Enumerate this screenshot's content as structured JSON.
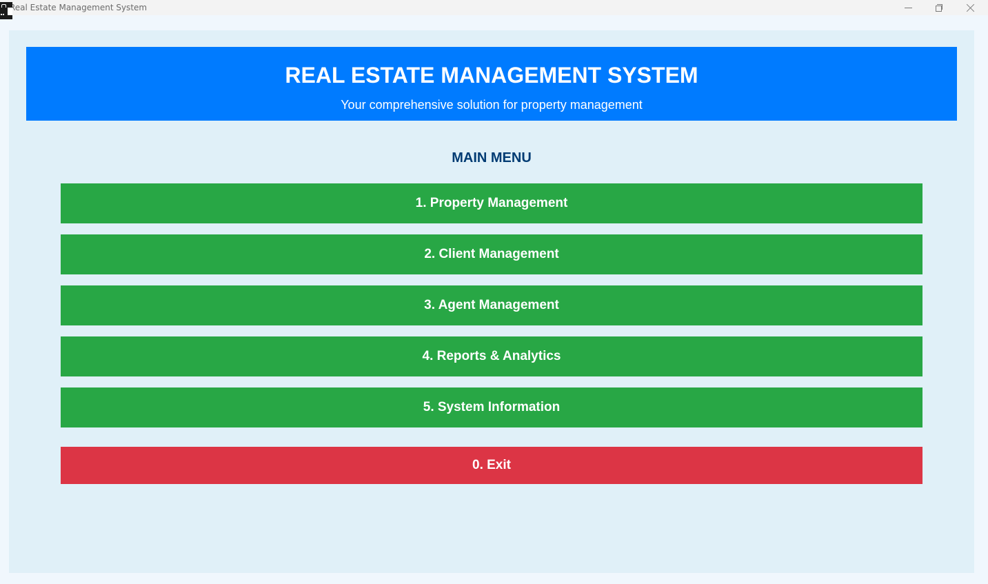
{
  "window": {
    "title": "Real Estate Management System"
  },
  "header": {
    "title": "REAL ESTATE MANAGEMENT SYSTEM",
    "subtitle": "Your comprehensive solution for property management"
  },
  "menu": {
    "title": "MAIN MENU",
    "items": [
      {
        "label": "1. Property Management"
      },
      {
        "label": "2. Client Management"
      },
      {
        "label": "3. Agent Management"
      },
      {
        "label": "4. Reports & Analytics"
      },
      {
        "label": "5. System Information"
      }
    ],
    "exit_label": "0. Exit"
  },
  "colors": {
    "header_bg": "#007bff",
    "menu_button": "#28a745",
    "exit_button": "#dc3545",
    "panel_bg": "#e0f0f8",
    "menu_title": "#003b73"
  },
  "icons": {
    "app": "app-icon",
    "minimize": "minimize-icon",
    "maximize": "restore-icon",
    "close": "close-icon"
  }
}
